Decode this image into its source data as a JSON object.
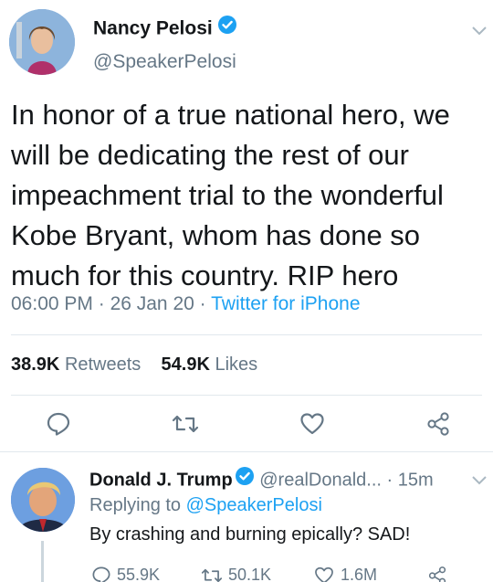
{
  "main_tweet": {
    "author_name": "Nancy Pelosi",
    "author_handle": "@SpeakerPelosi",
    "text": "In honor of a true national hero, we will be dedicating the rest of our impeachment trial to the wonderful Kobe Bryant, whom has done so much for this country. RIP hero",
    "time": "06:00 PM",
    "date": "26 Jan 20",
    "source": "Twitter for iPhone",
    "separator": " · ",
    "retweets_count": "38.9K",
    "retweets_label": "Retweets",
    "likes_count": "54.9K",
    "likes_label": "Likes"
  },
  "reply": {
    "author_name": "Donald J. Trump",
    "author_handle": "@realDonald...",
    "time": "· 15m",
    "replying_prefix": "Replying to ",
    "replying_to": "@SpeakerPelosi",
    "text": "By crashing and burning epically? SAD!",
    "reply_count": "55.9K",
    "retweet_count": "50.1K",
    "like_count": "1.6M"
  },
  "colors": {
    "verified": "#1da1f2",
    "link": "#1da1f2",
    "secondary": "#657786",
    "icon": "#657786"
  },
  "icons": [
    "verified-badge-icon",
    "chevron-down-icon",
    "reply-icon",
    "retweet-icon",
    "like-icon",
    "share-icon"
  ]
}
